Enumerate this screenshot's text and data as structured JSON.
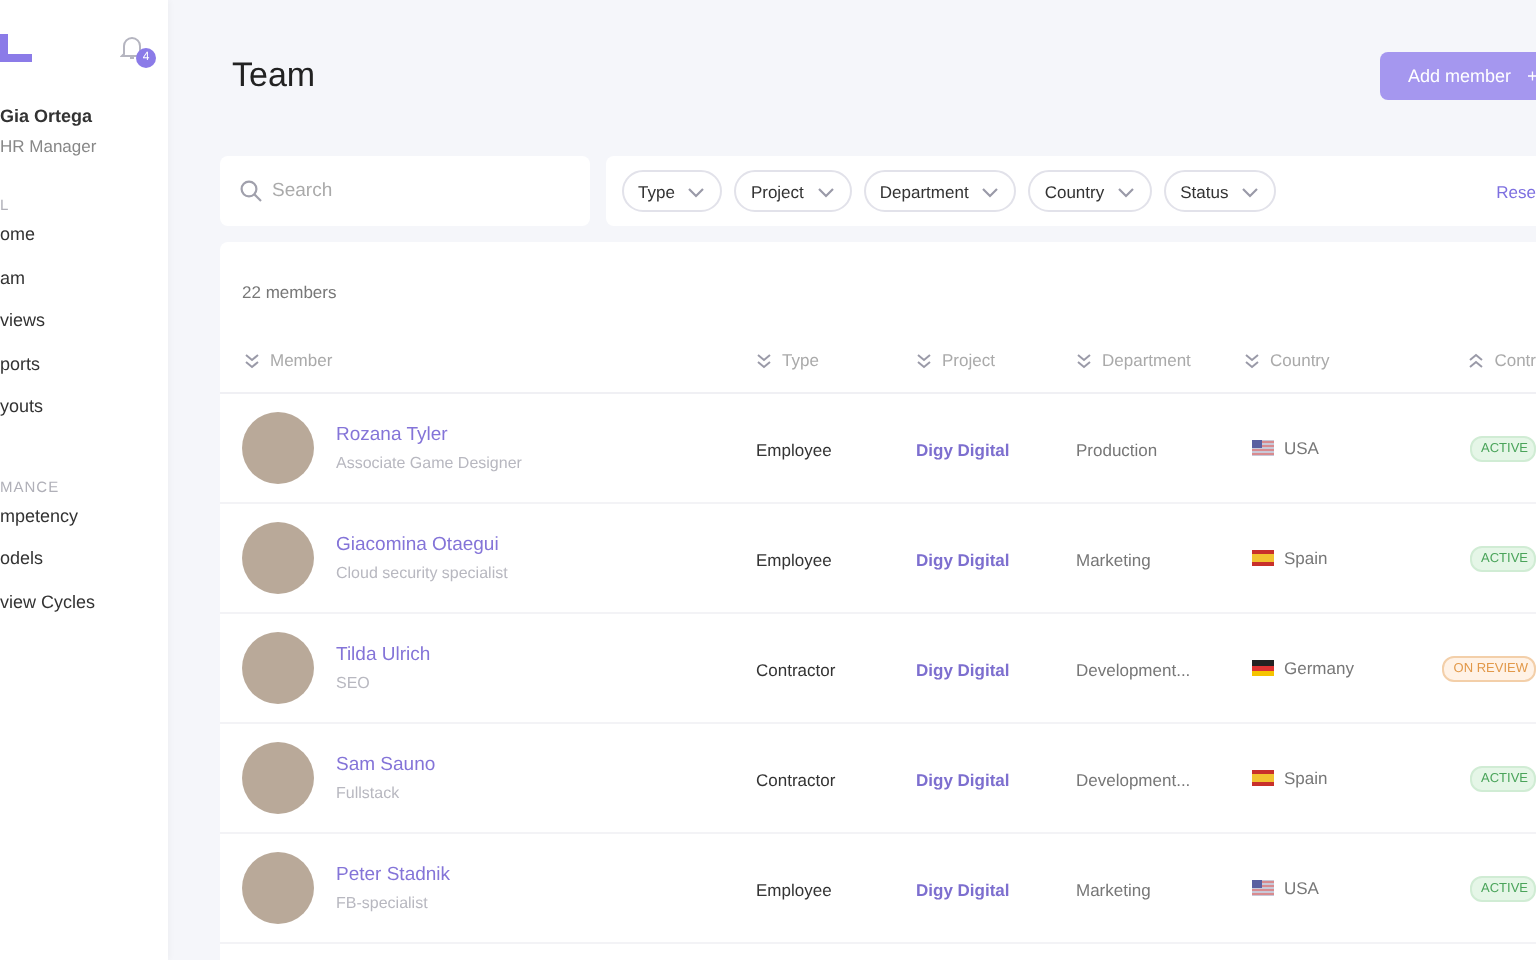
{
  "sidebar": {
    "user": {
      "name": "Gia Ortega",
      "role": "HR Manager"
    },
    "notifications": {
      "count": "4"
    },
    "sections": [
      {
        "title": "L",
        "items": [
          {
            "label": "ome",
            "selected": false
          },
          {
            "label": "am",
            "selected": false
          },
          {
            "label": "views",
            "selected": false
          },
          {
            "label": "ports",
            "selected": false
          },
          {
            "label": "youts",
            "selected": false
          }
        ]
      },
      {
        "title": "MANCE",
        "items": [
          {
            "label": "mpetency",
            "selected": false
          },
          {
            "label": "odels",
            "selected": false
          },
          {
            "label": "view Cycles",
            "selected": false
          }
        ]
      }
    ]
  },
  "page": {
    "title": "Team",
    "add_button": "Add member"
  },
  "search": {
    "placeholder": "Search"
  },
  "filters": [
    "Type",
    "Project",
    "Department",
    "Country",
    "Status"
  ],
  "reset_link": "Rese",
  "member_count": "22 members",
  "table": {
    "columns": [
      "Member",
      "Type",
      "Project",
      "Department",
      "Country",
      "Contr"
    ],
    "rows": [
      {
        "name": "Rozana Tyler",
        "role": "Associate Game Designer",
        "type": "Employee",
        "project": "Digy Digital",
        "department": "Production",
        "country": {
          "kind": "us",
          "label": "USA"
        },
        "status": {
          "kind": "active",
          "label": "ACTIVE"
        }
      },
      {
        "name": "Giacomina Otaegui",
        "role": "Cloud security specialist",
        "type": "Employee",
        "project": "Digy Digital",
        "department": "Marketing",
        "country": {
          "kind": "es",
          "label": "Spain"
        },
        "status": {
          "kind": "active",
          "label": "ACTIVE"
        }
      },
      {
        "name": "Tilda Ulrich",
        "role": "SEO",
        "type": "Contractor",
        "project": "Digy Digital",
        "department": "Development...",
        "country": {
          "kind": "de",
          "label": "Germany"
        },
        "status": {
          "kind": "review",
          "label": "ON REVIEW"
        }
      },
      {
        "name": "Sam Sauno",
        "role": "Fullstack",
        "type": "Contractor",
        "project": "Digy Digital",
        "department": "Development...",
        "country": {
          "kind": "es",
          "label": "Spain"
        },
        "status": {
          "kind": "active",
          "label": "ACTIVE"
        }
      },
      {
        "name": "Peter Stadnik",
        "role": "FB-specialist",
        "type": "Employee",
        "project": "Digy Digital",
        "department": "Marketing",
        "country": {
          "kind": "us",
          "label": "USA"
        },
        "status": {
          "kind": "active",
          "label": "ACTIVE"
        }
      }
    ]
  }
}
